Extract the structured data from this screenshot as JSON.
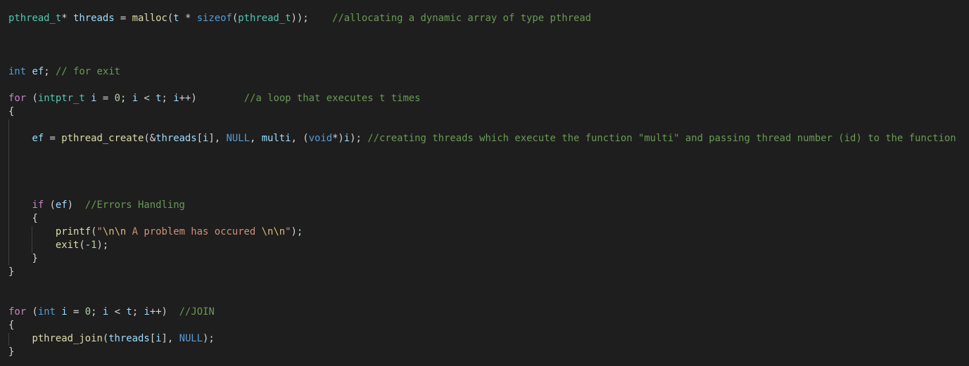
{
  "lines": [
    {
      "indent": "",
      "tokens": [
        {
          "c": "t",
          "x": "pthread_t"
        },
        {
          "c": "p",
          "x": "* "
        },
        {
          "c": "v",
          "x": "threads"
        },
        {
          "c": "p",
          "x": " = "
        },
        {
          "c": "f",
          "x": "malloc"
        },
        {
          "c": "p",
          "x": "("
        },
        {
          "c": "v",
          "x": "t"
        },
        {
          "c": "p",
          "x": " * "
        },
        {
          "c": "k",
          "x": "sizeof"
        },
        {
          "c": "p",
          "x": "("
        },
        {
          "c": "t",
          "x": "pthread_t"
        },
        {
          "c": "p",
          "x": "));    "
        },
        {
          "c": "c",
          "x": "//allocating a dynamic array of type pthread"
        }
      ]
    },
    {
      "indent": "",
      "tokens": [
        {
          "c": "k",
          "x": "int"
        },
        {
          "c": "p",
          "x": " "
        },
        {
          "c": "v",
          "x": "ef"
        },
        {
          "c": "p",
          "x": "; "
        },
        {
          "c": "c",
          "x": "// for exit"
        }
      ]
    },
    {
      "indent": "",
      "tokens": [
        {
          "c": "kc",
          "x": "for"
        },
        {
          "c": "p",
          "x": " ("
        },
        {
          "c": "t",
          "x": "intptr_t"
        },
        {
          "c": "p",
          "x": " "
        },
        {
          "c": "v",
          "x": "i"
        },
        {
          "c": "p",
          "x": " = "
        },
        {
          "c": "n",
          "x": "0"
        },
        {
          "c": "p",
          "x": "; "
        },
        {
          "c": "v",
          "x": "i"
        },
        {
          "c": "p",
          "x": " < "
        },
        {
          "c": "v",
          "x": "t"
        },
        {
          "c": "p",
          "x": "; "
        },
        {
          "c": "v",
          "x": "i"
        },
        {
          "c": "p",
          "x": "++)        "
        },
        {
          "c": "c",
          "x": "//a loop that executes t times"
        }
      ]
    },
    {
      "indent": "",
      "tokens": [
        {
          "c": "p",
          "x": "{"
        }
      ]
    },
    {
      "indent": "    ",
      "tokens": [
        {
          "c": "v",
          "x": "ef"
        },
        {
          "c": "p",
          "x": " = "
        },
        {
          "c": "f",
          "x": "pthread_create"
        },
        {
          "c": "p",
          "x": "(&"
        },
        {
          "c": "v",
          "x": "threads"
        },
        {
          "c": "p",
          "x": "["
        },
        {
          "c": "v",
          "x": "i"
        },
        {
          "c": "p",
          "x": "], "
        },
        {
          "c": "k",
          "x": "NULL"
        },
        {
          "c": "p",
          "x": ", "
        },
        {
          "c": "v",
          "x": "multi"
        },
        {
          "c": "p",
          "x": ", ("
        },
        {
          "c": "k",
          "x": "void"
        },
        {
          "c": "p",
          "x": "*)"
        },
        {
          "c": "v",
          "x": "i"
        },
        {
          "c": "p",
          "x": "); "
        },
        {
          "c": "c",
          "x": "//creating threads which execute the function \"multi\" and passing thread number (id) to the function"
        }
      ]
    },
    {
      "indent": "    ",
      "tokens": [
        {
          "c": "kc",
          "x": "if"
        },
        {
          "c": "p",
          "x": " ("
        },
        {
          "c": "v",
          "x": "ef"
        },
        {
          "c": "p",
          "x": ")  "
        },
        {
          "c": "c",
          "x": "//Errors Handling"
        }
      ]
    },
    {
      "indent": "    ",
      "tokens": [
        {
          "c": "p",
          "x": "{"
        }
      ]
    },
    {
      "indent": "        ",
      "tokens": [
        {
          "c": "f",
          "x": "printf"
        },
        {
          "c": "p",
          "x": "("
        },
        {
          "c": "s",
          "x": "\""
        },
        {
          "c": "e",
          "x": "\\n\\n"
        },
        {
          "c": "s",
          "x": " A problem has occured "
        },
        {
          "c": "e",
          "x": "\\n\\n"
        },
        {
          "c": "s",
          "x": "\""
        },
        {
          "c": "p",
          "x": ");"
        }
      ]
    },
    {
      "indent": "        ",
      "tokens": [
        {
          "c": "f",
          "x": "exit"
        },
        {
          "c": "p",
          "x": "(-"
        },
        {
          "c": "n",
          "x": "1"
        },
        {
          "c": "p",
          "x": ");"
        }
      ]
    },
    {
      "indent": "    ",
      "tokens": [
        {
          "c": "p",
          "x": "}"
        }
      ]
    },
    {
      "indent": "",
      "tokens": [
        {
          "c": "p",
          "x": "}"
        }
      ]
    },
    {
      "indent": "",
      "tokens": [
        {
          "c": "kc",
          "x": "for"
        },
        {
          "c": "p",
          "x": " ("
        },
        {
          "c": "k",
          "x": "int"
        },
        {
          "c": "p",
          "x": " "
        },
        {
          "c": "v",
          "x": "i"
        },
        {
          "c": "p",
          "x": " = "
        },
        {
          "c": "n",
          "x": "0"
        },
        {
          "c": "p",
          "x": "; "
        },
        {
          "c": "v",
          "x": "i"
        },
        {
          "c": "p",
          "x": " < "
        },
        {
          "c": "v",
          "x": "t"
        },
        {
          "c": "p",
          "x": "; "
        },
        {
          "c": "v",
          "x": "i"
        },
        {
          "c": "p",
          "x": "++)  "
        },
        {
          "c": "c",
          "x": "//JOIN"
        }
      ]
    },
    {
      "indent": "",
      "tokens": [
        {
          "c": "p",
          "x": "{"
        }
      ]
    },
    {
      "indent": "    ",
      "tokens": [
        {
          "c": "f",
          "x": "pthread_join"
        },
        {
          "c": "p",
          "x": "("
        },
        {
          "c": "v",
          "x": "threads"
        },
        {
          "c": "p",
          "x": "["
        },
        {
          "c": "v",
          "x": "i"
        },
        {
          "c": "p",
          "x": "], "
        },
        {
          "c": "k",
          "x": "NULL"
        },
        {
          "c": "p",
          "x": ");"
        }
      ]
    },
    {
      "indent": "",
      "tokens": [
        {
          "c": "p",
          "x": "}"
        }
      ]
    }
  ],
  "theme": {
    "background": "#1e1e1e",
    "type": "#4ec9b0",
    "variable": "#9cdcfe",
    "function": "#dcdcaa",
    "keyword": "#569cd6",
    "control": "#c586c0",
    "comment": "#6a9955",
    "number": "#b5cea8",
    "string": "#ce9178",
    "escape": "#d7ba7d"
  }
}
